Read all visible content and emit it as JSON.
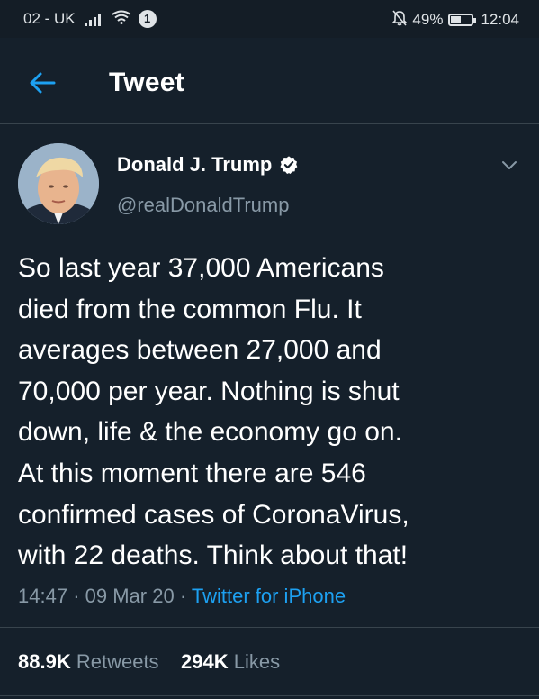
{
  "status_bar": {
    "carrier": "02 - UK",
    "notification_count": "1",
    "battery_percent": "49%",
    "battery_level": 0.49,
    "time": "12:04"
  },
  "header": {
    "title": "Tweet",
    "back_icon": "arrow-left-icon"
  },
  "tweet": {
    "display_name": "Donald J. Trump",
    "handle": "@realDonaldTrump",
    "verified_icon": "verified-badge-icon",
    "text_lines": [
      "So last year 37,000 Americans",
      "died from the common Flu. It",
      "averages between 27,000 and",
      "70,000 per year. Nothing is shut",
      "down, life & the economy go on.",
      "At this moment there are 546",
      "confirmed cases of CoronaVirus,",
      "with 22 deaths. Think about that!"
    ],
    "time": "14:47",
    "date": "09 Mar 20",
    "separator": "·",
    "source": "Twitter for iPhone"
  },
  "stats": {
    "retweets_count": "88.9K",
    "retweets_label": "Retweets",
    "likes_count": "294K",
    "likes_label": "Likes"
  },
  "colors": {
    "background": "#15202b",
    "accent": "#1da1f2",
    "secondary_text": "#8899a6",
    "border": "#38444d"
  }
}
